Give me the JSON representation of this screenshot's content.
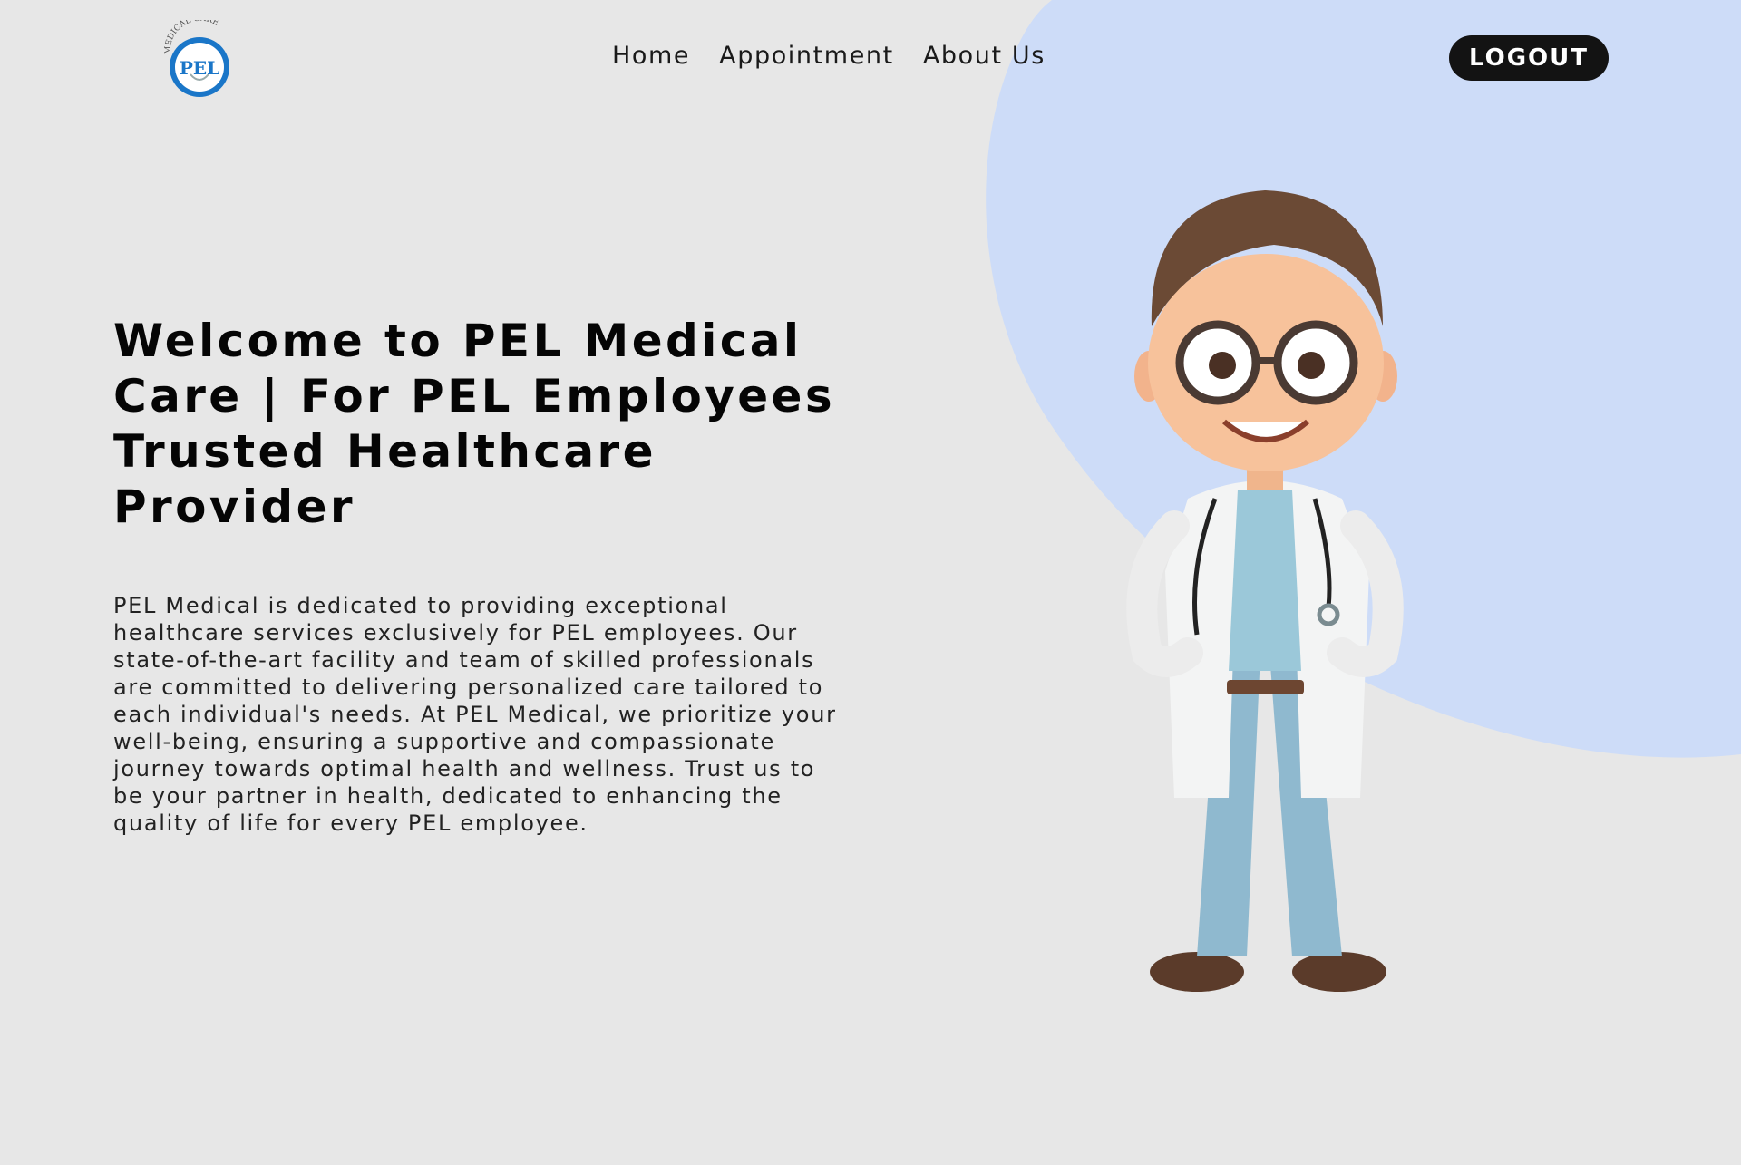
{
  "header": {
    "logo": {
      "arc_text": "MEDICAL CARE",
      "brand": "PEL"
    },
    "nav": [
      {
        "label": "Home"
      },
      {
        "label": "Appointment"
      },
      {
        "label": "About Us"
      }
    ],
    "logout_label": "LOGOUT"
  },
  "hero": {
    "title": "Welcome to PEL Medical Care | For PEL Employees Trusted Healthcare Provider",
    "description": "PEL Medical is dedicated to providing exceptional healthcare services exclusively for PEL employees. Our state-of-the-art facility and team of skilled professionals are committed to delivering personalized care tailored to each individual's needs. At PEL Medical, we prioritize your well-being, ensuring a supportive and compassionate journey towards optimal health and wellness. Trust us to be your partner in health, dedicated to enhancing the quality of life for every PEL employee."
  },
  "illustration": {
    "icon": "doctor-illustration-icon"
  },
  "colors": {
    "background": "#e7e7e7",
    "blob": "#cddcf8",
    "logout_bg": "#131313",
    "logo_blue": "#1a76c8"
  }
}
